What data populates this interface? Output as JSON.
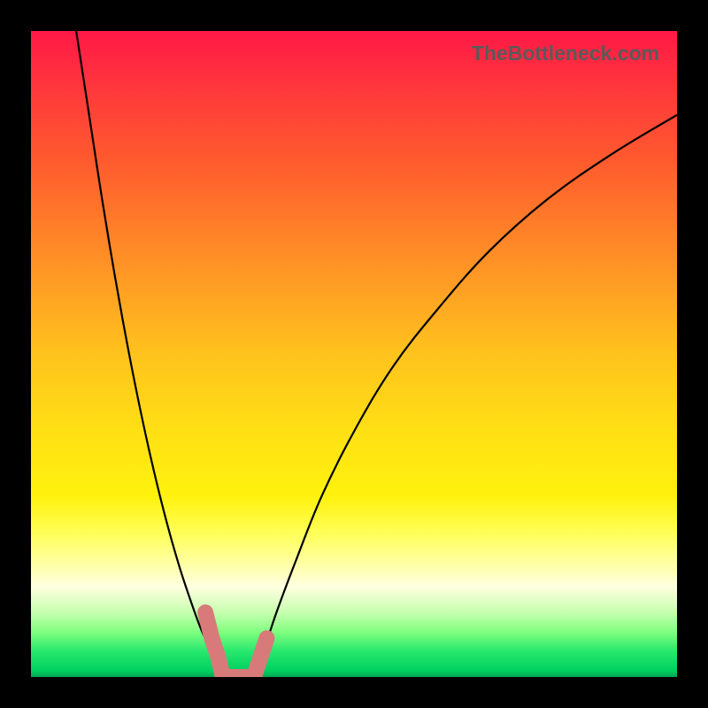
{
  "watermark": "TheBottleneck.com",
  "chart_data": {
    "type": "line",
    "title": "",
    "xlabel": "",
    "ylabel": "",
    "xrange": [
      0,
      100
    ],
    "yrange": [
      0,
      100
    ],
    "series": [
      {
        "name": "bottleneck-curve-left",
        "x": [
          7,
          9,
          11,
          13,
          15,
          17,
          19,
          21,
          23,
          25,
          26.5,
          28,
          29,
          29.7
        ],
        "y": [
          100,
          87,
          74,
          62,
          51,
          41,
          32,
          24,
          17,
          11,
          7,
          4,
          2,
          0
        ]
      },
      {
        "name": "bottleneck-curve-right",
        "x": [
          34.5,
          36,
          38,
          41,
          45,
          50,
          56,
          63,
          71,
          80,
          90,
          100
        ],
        "y": [
          0,
          4,
          10,
          18,
          28,
          38,
          48,
          57,
          66,
          74,
          81,
          87
        ]
      },
      {
        "name": "valley-marker",
        "x": [
          27,
          28,
          29,
          29.7,
          31,
          33,
          34.5,
          35.5,
          36.5
        ],
        "y": [
          10,
          6,
          3,
          0,
          0,
          0,
          0,
          3,
          6
        ]
      }
    ],
    "gradient_stops": [
      {
        "pos": 0,
        "color": "#ff1846"
      },
      {
        "pos": 50,
        "color": "#ffc31d"
      },
      {
        "pos": 78,
        "color": "#ffff5c"
      },
      {
        "pos": 100,
        "color": "#00a850"
      }
    ]
  }
}
